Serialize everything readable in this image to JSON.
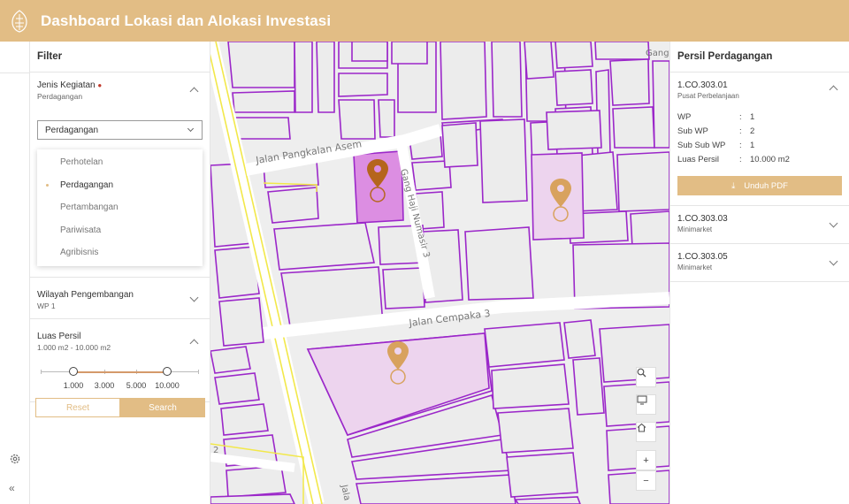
{
  "header": {
    "title": "Dashboard Lokasi dan Alokasi Investasi"
  },
  "filter": {
    "title": "Filter",
    "jenis_kegiatan": {
      "label": "Jenis Kegiatan",
      "value": "Perdagangan",
      "select_value": "Perdagangan",
      "options": [
        "Perhotelan",
        "Perdagangan",
        "Pertambangan",
        "Pariwisata",
        "Agribisnis"
      ]
    },
    "wilayah": {
      "label": "Wilayah Pengembangan",
      "value": "WP 1"
    },
    "luas": {
      "label": "Luas Persil",
      "value": "1.000 m2 - 10.000 m2",
      "ticks": [
        "1.000",
        "3.000",
        "5.000",
        "10.000"
      ],
      "range": [
        1000,
        10000
      ]
    },
    "reset_label": "Reset",
    "search_label": "Search"
  },
  "map": {
    "streets": [
      "Jalan Pangkalan Asem",
      "Gang Haji Numasir 3",
      "Jalan Cempaka 3",
      "Gang",
      "Jala",
      "2"
    ],
    "controls": [
      "search-icon",
      "monitor-icon",
      "home-icon",
      "zoom-in-icon",
      "zoom-out-icon"
    ],
    "zoom_in": "+",
    "zoom_out": "−"
  },
  "right_panel": {
    "title": "Persil Perdagangan",
    "items": [
      {
        "code": "1.CO.303.01",
        "type": "Pusat Perbelanjaan",
        "expanded": true,
        "fields": [
          {
            "k": "WP",
            "v": "1"
          },
          {
            "k": "Sub WP",
            "v": "2"
          },
          {
            "k": "Sub Sub WP",
            "v": "1"
          },
          {
            "k": "Luas Persil",
            "v": "10.000 m2"
          }
        ],
        "download_label": "Unduh PDF"
      },
      {
        "code": "1.CO.303.03",
        "type": "Minimarket",
        "expanded": false
      },
      {
        "code": "1.CO.303.05",
        "type": "Minimarket",
        "expanded": false
      }
    ]
  },
  "colors": {
    "accent": "#e2bd85",
    "parcel": "#9b27c9",
    "road": "#f2e84a",
    "pin_active": "#b5651d",
    "pin": "#d8a25e"
  }
}
